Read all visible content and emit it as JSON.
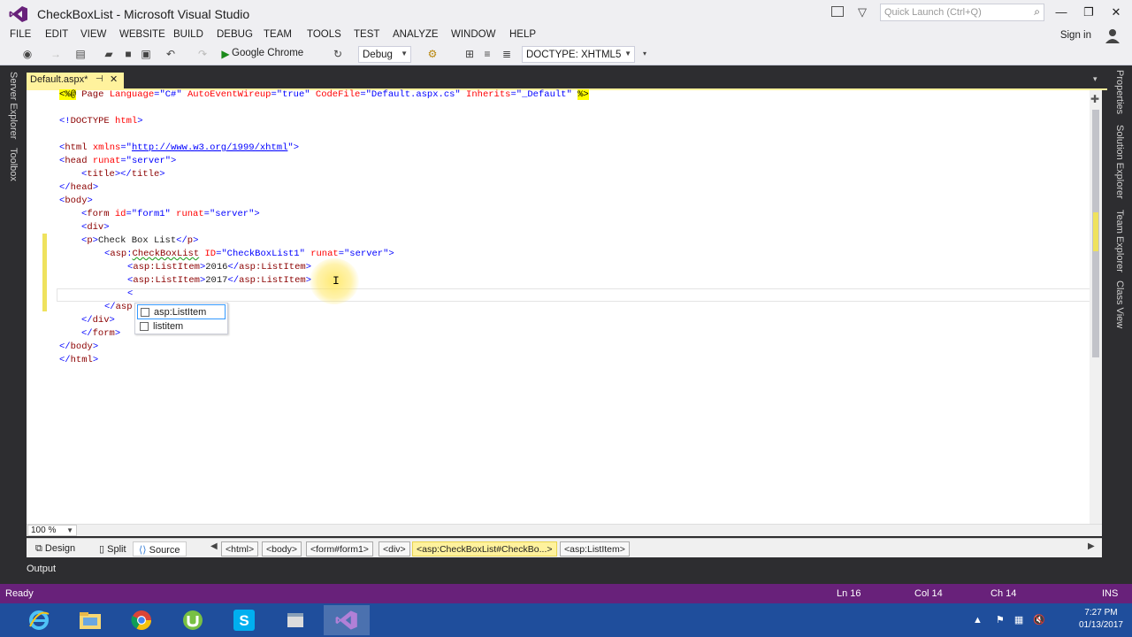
{
  "window": {
    "title": "CheckBoxList - Microsoft Visual Studio",
    "quick_launch_placeholder": "Quick Launch (Ctrl+Q)"
  },
  "menu": {
    "items": [
      "FILE",
      "EDIT",
      "VIEW",
      "WEBSITE",
      "BUILD",
      "DEBUG",
      "TEAM",
      "TOOLS",
      "TEST",
      "ANALYZE",
      "WINDOW",
      "HELP"
    ],
    "sign_in": "Sign in"
  },
  "toolbar": {
    "browser": "Google Chrome",
    "configuration": "Debug",
    "doctype": "DOCTYPE: XHTML5"
  },
  "left_tabs": [
    "Server Explorer",
    "Toolbox"
  ],
  "right_tabs": [
    "Properties",
    "Solution Explorer",
    "Team Explorer",
    "Class View"
  ],
  "document": {
    "tab_label": "Default.aspx*"
  },
  "code": {
    "line1": [
      "<%@",
      " Page ",
      "Language",
      "=\"C#\" ",
      "AutoEventWireup",
      "=\"true\" ",
      "CodeFile",
      "=\"Default.aspx.cs\" ",
      "Inherits",
      "=\"_Default\" ",
      "%>"
    ],
    "doctype": [
      "<!",
      "DOCTYPE ",
      "html",
      ">"
    ],
    "html_open": [
      "<",
      "html ",
      "xmlns",
      "=\"",
      "http://www.w3.org/1999/xhtml",
      "\">"
    ],
    "head_open": [
      "<",
      "head ",
      "runat",
      "=\"server\">"
    ],
    "title": [
      "<",
      "title",
      "></",
      "title",
      ">"
    ],
    "head_close": [
      "</",
      "head",
      ">"
    ],
    "body_open": [
      "<",
      "body",
      ">"
    ],
    "form_open": [
      "<",
      "form ",
      "id",
      "=\"form1\" ",
      "runat",
      "=\"server\">"
    ],
    "div_open": [
      "<",
      "div",
      ">"
    ],
    "p": [
      "<",
      "p",
      ">",
      "Check Box List",
      "</",
      "p",
      ">"
    ],
    "cbl_open": [
      "<",
      "asp",
      ":",
      "CheckBoxList",
      " ID",
      "=\"CheckBoxList1\" ",
      "runat",
      "=\"server\">"
    ],
    "item1": [
      "<",
      "asp:ListItem",
      ">",
      "2016",
      "</",
      "asp:ListItem",
      ">"
    ],
    "item2": [
      "<",
      "asp:ListItem",
      ">",
      "2017",
      "</",
      "asp:ListItem",
      ">"
    ],
    "typing": "<",
    "cbl_close": [
      "</",
      "asp"
    ],
    "div_close": [
      "</",
      "div",
      ">"
    ],
    "form_close": [
      "</",
      "form",
      ">"
    ],
    "body_close": [
      "</",
      "body",
      ">"
    ],
    "html_close": [
      "</",
      "html",
      ">"
    ]
  },
  "intellisense": {
    "items": [
      "asp:ListItem",
      "listitem"
    ]
  },
  "zoom": "100 %",
  "views": {
    "design": "Design",
    "split": "Split",
    "source": "Source"
  },
  "breadcrumbs": [
    "<html>",
    "<body>",
    "<form#form1>",
    "<div>",
    "<asp:CheckBoxList#CheckBo...>",
    "<asp:ListItem>"
  ],
  "output_tab": "Output",
  "status": {
    "state": "Ready",
    "line": "Ln 16",
    "col": "Col 14",
    "ch": "Ch 14",
    "mode": "INS"
  },
  "clock": {
    "time": "7:27 PM",
    "date": "01/13/2017"
  },
  "colors": {
    "status_bar": "#68217a",
    "active_tab": "#fff29d",
    "taskbar": "#1f4e9c"
  }
}
